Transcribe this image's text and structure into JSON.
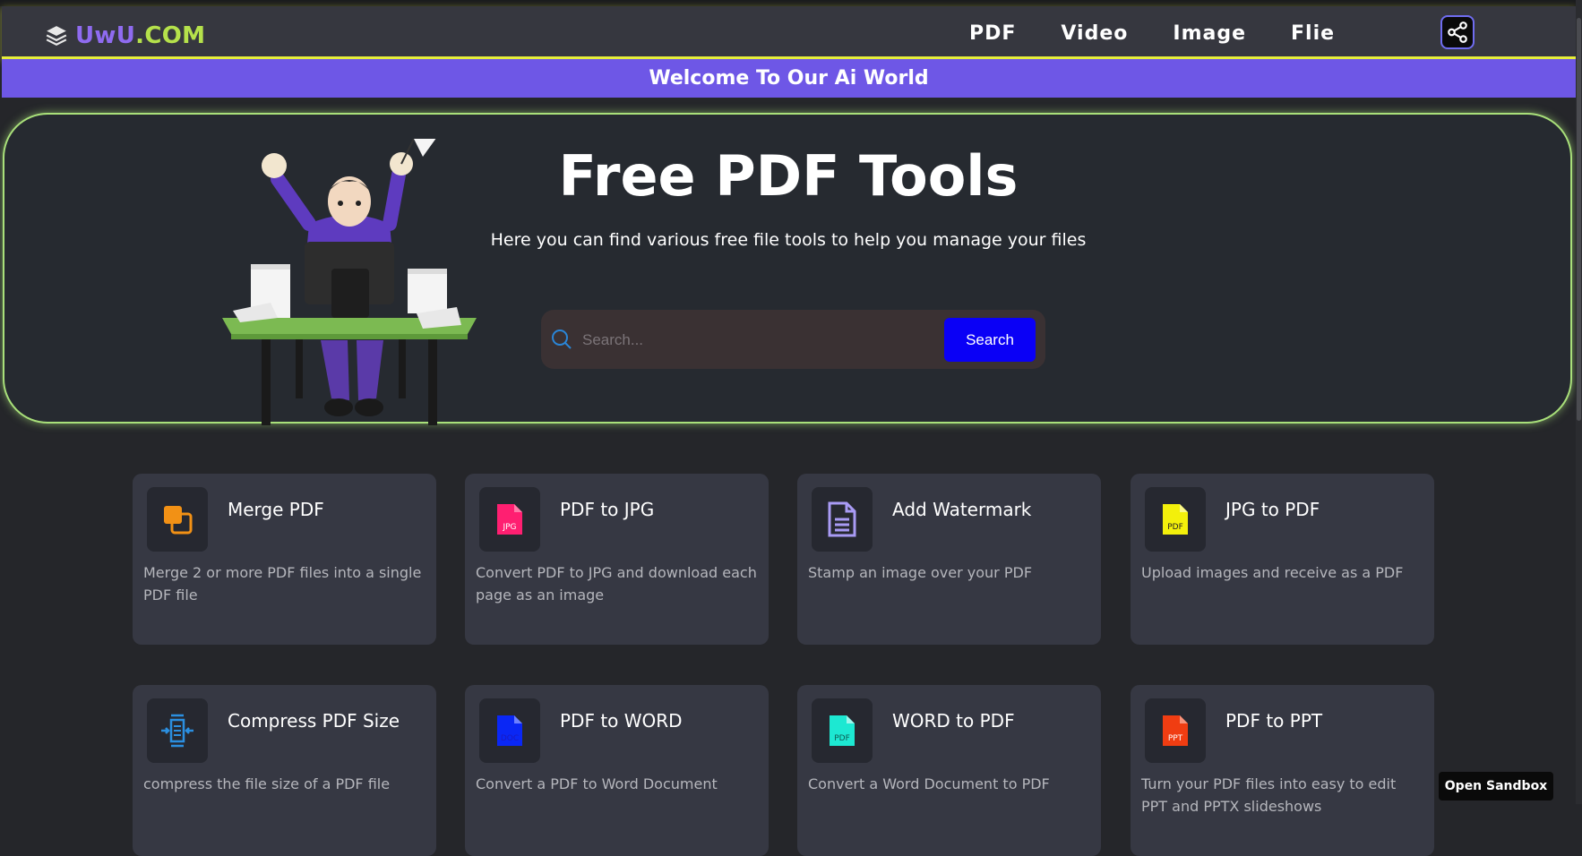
{
  "header": {
    "logo_part_a": "UwU",
    "logo_part_b": ".COM",
    "nav": [
      {
        "label": "PDF"
      },
      {
        "label": "Video"
      },
      {
        "label": "Image"
      },
      {
        "label": "Flie"
      }
    ],
    "share_icon": "share-icon"
  },
  "banner": {
    "text": "Welcome To Our Ai World"
  },
  "hero": {
    "title": "Free PDF Tools",
    "subtitle": "Here you can find various free file tools to help you manage your files",
    "search_placeholder": "Search...",
    "search_button": "Search"
  },
  "tools": [
    {
      "title": "Merge PDF",
      "desc": "Merge 2 or more PDF files into a single PDF file",
      "icon": "merge-icon",
      "color": "#f29115"
    },
    {
      "title": "PDF to JPG",
      "desc": "Convert PDF to JPG and download each page as an image",
      "icon": "jpg-file-icon",
      "color": "#ff1f71"
    },
    {
      "title": "Add Watermark",
      "desc": "Stamp an image over your PDF",
      "icon": "document-icon",
      "color": "#a99bf5"
    },
    {
      "title": "JPG to PDF",
      "desc": "Upload images and receive as a PDF",
      "icon": "pdf-file-icon",
      "color": "#f3f00b"
    },
    {
      "title": "Compress PDF Size",
      "desc": "compress the file size of a PDF file",
      "icon": "compress-icon",
      "color": "#2b8fe0"
    },
    {
      "title": "PDF to WORD",
      "desc": "Convert a PDF to Word Document",
      "icon": "doc-file-icon",
      "color": "#0a27f5"
    },
    {
      "title": "WORD to PDF",
      "desc": "Convert a Word Document to PDF",
      "icon": "pdf-file-icon",
      "color": "#1de8d2"
    },
    {
      "title": "PDF to PPT",
      "desc": "Turn your PDF files into easy to edit PPT and PPTX slideshows",
      "icon": "ppt-file-icon",
      "color": "#f03d12"
    }
  ],
  "sandbox": {
    "label": "Open Sandbox"
  }
}
